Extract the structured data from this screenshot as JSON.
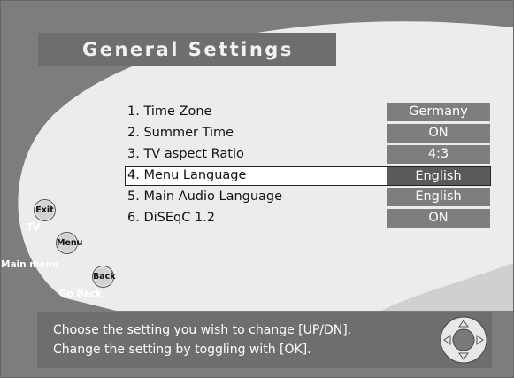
{
  "screen": {
    "title": "General Settings"
  },
  "settings": [
    {
      "label": "1. Time Zone",
      "value": "Germany",
      "selected": false
    },
    {
      "label": "2. Summer Time",
      "value": "ON",
      "selected": false
    },
    {
      "label": "3. TV aspect Ratio",
      "value": "4:3",
      "selected": false
    },
    {
      "label": "4. Menu Language",
      "value": "English",
      "selected": true
    },
    {
      "label": "5. Main Audio Language",
      "value": "English",
      "selected": false
    },
    {
      "label": "6. DiSEqC 1.2",
      "value": "ON",
      "selected": false
    }
  ],
  "remote_buttons": {
    "exit": {
      "label": "Exit",
      "caption": "TV"
    },
    "menu": {
      "label": "Menu",
      "caption": "Main menu"
    },
    "back": {
      "label": "Back",
      "caption": "Go Back"
    }
  },
  "help": {
    "line1": "Choose the setting you wish to change [UP/DN].",
    "line2": "Change the setting by toggling with [OK]."
  },
  "icons": {
    "nav_pad": "directional-pad-icon"
  },
  "colors": {
    "background_gray": "#7d7d7d",
    "panel_light": "#ebebeb",
    "bar_gray": "#6e6e6e",
    "value_box": "#7e7e7e"
  }
}
